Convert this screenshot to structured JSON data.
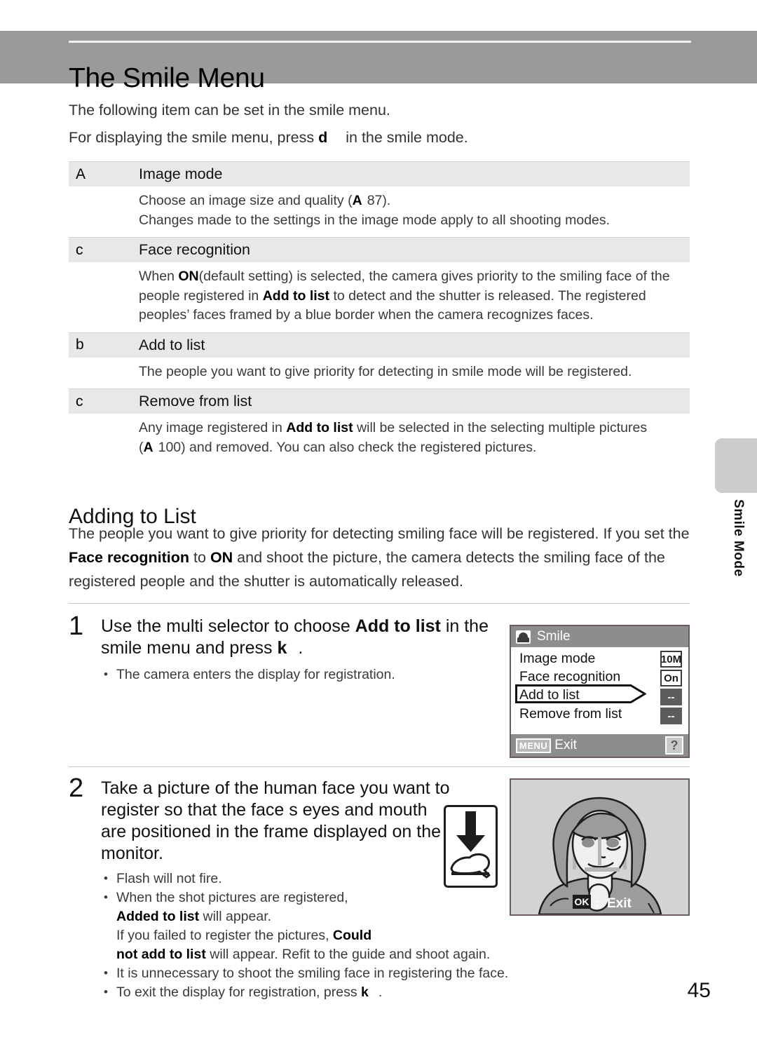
{
  "page": {
    "number": "45",
    "side_tab": "Smile Mode"
  },
  "header": {
    "title": "The Smile Menu"
  },
  "intro": {
    "line1": "The following item can be set in the smile menu.",
    "line2_before": "For displaying the smile menu, press ",
    "line2_key": "d",
    "line2_after": "in the smile mode."
  },
  "table": {
    "rows": [
      {
        "icon": "A",
        "name": "Image mode",
        "body_lines": [
          "Choose an image size and quality (A 87).",
          "Changes made to the settings in the image mode apply to all shooting modes."
        ]
      },
      {
        "icon": "c",
        "name": "Face recognition",
        "body_lines": [
          "When ON (default setting) is selected, the camera gives priority to the smiling face of the people registered in Add to list to detect and the shutter is released. The registered peoples' faces framed by a blue border when the camera recognizes faces."
        ]
      },
      {
        "icon": "b",
        "name": "Add to list",
        "body_lines": [
          "The people you want to give priority for detecting in smile mode will be registered."
        ]
      },
      {
        "icon": "c",
        "name": "Remove from list",
        "body_lines": [
          "Any image registered in Add to list will be selected in the selecting multiple pictures (A 100) and removed. You can also check the registered pictures."
        ]
      }
    ]
  },
  "section": {
    "heading": "Adding to List",
    "paragraph": "The people you want to give priority for detecting smiling face will be registered. If you set the Face recognition to ON and shoot the picture, the camera detects the smiling face of the registered people and the shutter is automatically released."
  },
  "steps": [
    {
      "number": "1",
      "instruction": "Use the multi selector to choose Add to list in the smile menu and press k.",
      "bullets": [
        "The camera enters the display for registration."
      ]
    },
    {
      "number": "2",
      "instruction": "Take a picture of the human face you want to register so that the face s eyes and mouth are positioned in the frame displayed on the monitor.",
      "bullets": [
        "Flash will not fire.",
        "When the shot pictures are registered, Added to list will appear.",
        "If you failed to register the pictures, Could not add to list will appear. Refit to the guide and shoot again.",
        "It is unnecessary to shoot the smiling face in registering the face.",
        "To exit the display for registration, press k."
      ]
    }
  ],
  "camera_menu": {
    "title": "Smile",
    "items": [
      {
        "label": "Image mode",
        "value": "10M"
      },
      {
        "label": "Face recognition",
        "value": "On"
      },
      {
        "label": "Add to list",
        "value": "--"
      },
      {
        "label": "Remove from list",
        "value": "--"
      }
    ],
    "selected_index": 2,
    "footer": {
      "menu_key": "MENU",
      "exit_label": "Exit",
      "help_key": "?"
    }
  },
  "camera_photo": {
    "ok_key": "OK",
    "separator": ":",
    "exit_label": "Exit"
  },
  "colors": {
    "header_band": "#9a9a9a",
    "table_head": "#e8e8e8",
    "tab": "#cccccc",
    "monitor_chrome": "#8d8d8d"
  }
}
